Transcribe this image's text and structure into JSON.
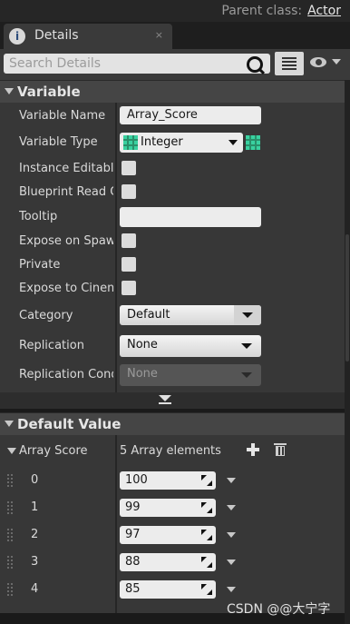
{
  "header": {
    "parent_class_label": "Parent class:",
    "parent_class_value": "Actor"
  },
  "tab": {
    "label": "Details",
    "close": "×",
    "icon": "details-icon"
  },
  "search": {
    "placeholder": "Search Details"
  },
  "variable_section": {
    "title": "Variable",
    "rows": {
      "variable_name": {
        "label": "Variable Name",
        "value": "Array_Score"
      },
      "variable_type": {
        "label": "Variable Type",
        "value": "Integer"
      },
      "instance_editable": {
        "label": "Instance Editable"
      },
      "blueprint_read_only": {
        "label": "Blueprint Read Only"
      },
      "tooltip": {
        "label": "Tooltip",
        "value": ""
      },
      "expose_on_spawn": {
        "label": "Expose on Spawn"
      },
      "private": {
        "label": "Private"
      },
      "expose_to_cinematics": {
        "label": "Expose to Cinematics"
      },
      "category": {
        "label": "Category",
        "value": "Default"
      },
      "replication": {
        "label": "Replication",
        "value": "None"
      },
      "replication_condition": {
        "label": "Replication Condition",
        "value": "None"
      }
    }
  },
  "default_value_section": {
    "title": "Default Value",
    "array": {
      "label": "Array Score",
      "count_text": "5 Array elements",
      "elements": [
        {
          "index": "0",
          "value": "100"
        },
        {
          "index": "1",
          "value": "99"
        },
        {
          "index": "2",
          "value": "97"
        },
        {
          "index": "3",
          "value": "88"
        },
        {
          "index": "4",
          "value": "85"
        }
      ]
    }
  },
  "watermark": "CSDN @@大宁字",
  "colors": {
    "integer_pin": "#39d1a0",
    "section_header": "#454545",
    "panel": "#373737"
  }
}
